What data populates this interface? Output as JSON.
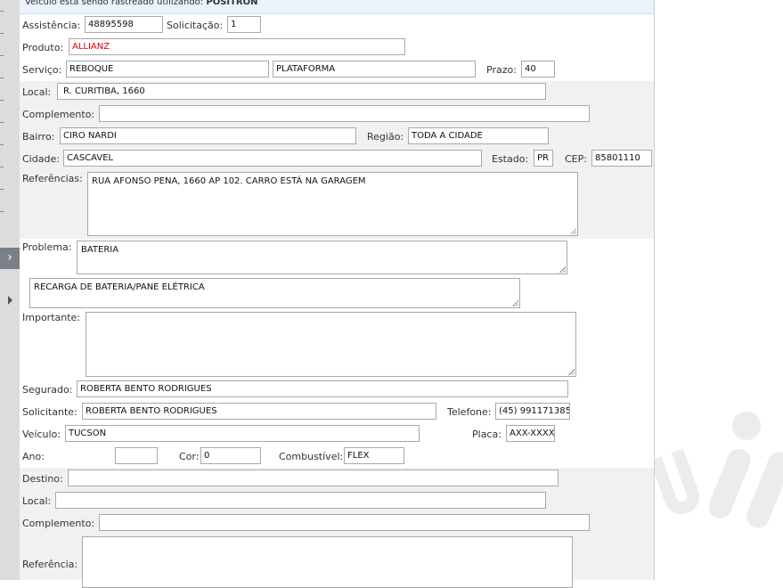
{
  "notice": {
    "prefix": "Veículo está sendo rastreado utilizando:",
    "provider": "POSITRON"
  },
  "labels": {
    "assistencia": "Assistência:",
    "solicitacao": "Solicitação:",
    "produto": "Produto:",
    "servico": "Serviço:",
    "prazo": "Prazo:",
    "local": "Local:",
    "complemento": "Complemento:",
    "bairro": "Bairro:",
    "regiao": "Região:",
    "cidade": "Cidade:",
    "estado": "Estado:",
    "cep": "CEP:",
    "referencias": "Referências:",
    "problema": "Problema:",
    "importante": "Importante:",
    "segurado": "Segurado:",
    "solicitante": "Solicitante:",
    "telefone": "Telefone:",
    "veiculo": "Veículo:",
    "placa": "Placa:",
    "ano": "Ano:",
    "cor": "Cor:",
    "combustivel": "Combustível:",
    "destino": "Destino:",
    "local2": "Local:",
    "complemento2": "Complemento:",
    "referencia": "Referência:"
  },
  "values": {
    "assistencia": "48895598",
    "solicitacao": "1",
    "produto": "ALLIANZ",
    "servico": "REBOQUE",
    "servico2": "PLATAFORMA",
    "prazo": "40",
    "local": "R. CURITIBA, 1660",
    "complemento": "",
    "bairro": "CIRO NARDI",
    "regiao": "TODA A CIDADE",
    "cidade": "CASCAVEL",
    "estado": "PR",
    "cep": "85801110",
    "referencias": "RUA AFONSO PENA, 1660 AP 102. CARRO ESTÁ NA GARAGEM",
    "problema": "BATERIA",
    "problema_detalhe": "RECARGA DE BATERIA/PANE ELÉTRICA",
    "importante": "",
    "segurado": "ROBERTA BENTO RODRIGUES",
    "solicitante": "ROBERTA BENTO RODRIGUES",
    "telefone": "(45) 991171385",
    "veiculo": "TUCSON",
    "placa": "AXX-XXXX",
    "ano": "",
    "cor": "0",
    "combustivel": "FLEX",
    "destino": "",
    "local2": "",
    "complemento2": "",
    "referencia": ""
  },
  "colors": {
    "produto": "#e00000",
    "notice_bg": "#eaf3fb",
    "band": "#f1f1f1"
  },
  "icons": {
    "sidebar_toggle": "chevron-right-icon",
    "tree_arrow": "triangle-right-icon"
  }
}
